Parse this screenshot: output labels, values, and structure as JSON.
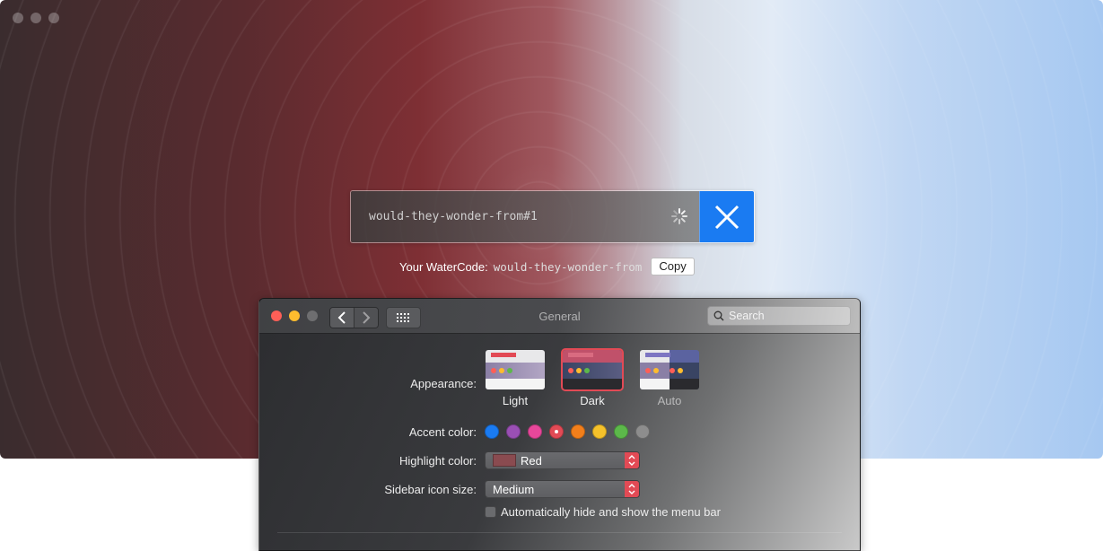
{
  "code_bar": {
    "value": "would-they-wonder-from#1"
  },
  "watercode": {
    "label": "Your WaterCode:",
    "value": "would-they-wonder-from",
    "copy_label": "Copy"
  },
  "prefs": {
    "title": "General",
    "search_placeholder": "Search",
    "appearance": {
      "label": "Appearance:",
      "options": [
        {
          "label": "Light",
          "selected": false
        },
        {
          "label": "Dark",
          "selected": true
        },
        {
          "label": "Auto",
          "selected": false
        }
      ]
    },
    "accent": {
      "label": "Accent color:",
      "colors": [
        "#1a7bf2",
        "#9a4fb4",
        "#e8479b",
        "#e24a55",
        "#f27f1b",
        "#f5c12a",
        "#5cb84a",
        "#8d8d8d"
      ],
      "selected_index": 3
    },
    "highlight": {
      "label": "Highlight color:",
      "value": "Red"
    },
    "sidebar_icon_size": {
      "label": "Sidebar icon size:",
      "value": "Medium"
    },
    "menu_bar": {
      "label": "Automatically hide and show the menu bar",
      "checked": false
    }
  },
  "colors": {
    "accent_blue": "#1a7bf2",
    "accent_red": "#e24a55",
    "traffic_close": "#fe5f57",
    "traffic_minimize": "#febc2e",
    "traffic_zoom": "#6e6e70"
  }
}
